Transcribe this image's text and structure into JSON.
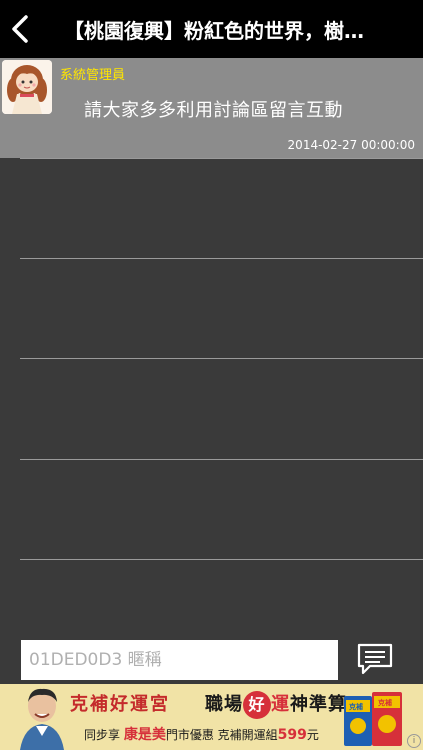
{
  "header": {
    "title": "【桃園復興】粉紅色的世界，樹…"
  },
  "post": {
    "poster_name": "系統管理員",
    "message": "請大家多多利用討論區留言互動",
    "timestamp": "2014-02-27 00:00:00"
  },
  "comment_input": {
    "placeholder": "01DED0D3 暱稱"
  },
  "ad": {
    "line1_a": "克補好運宮",
    "line1_b": "職場",
    "line1_good": "好",
    "line1_luck": "運",
    "line1_c": "神準算!",
    "line2_a": "同步享",
    "line2_brand": "康是美",
    "line2_b": "門市優惠  克補開運組",
    "line2_price": "599",
    "line2_unit": "元",
    "info": "i",
    "product_label": "克補",
    "colors": {
      "bg": "#f1e3a6",
      "accent": "#d6303a"
    }
  },
  "colors": {
    "header_bg": "#000000",
    "post_bg": "#8c8c8c",
    "poster_name": "#ffe600",
    "body_bg": "#3a3a3a"
  }
}
